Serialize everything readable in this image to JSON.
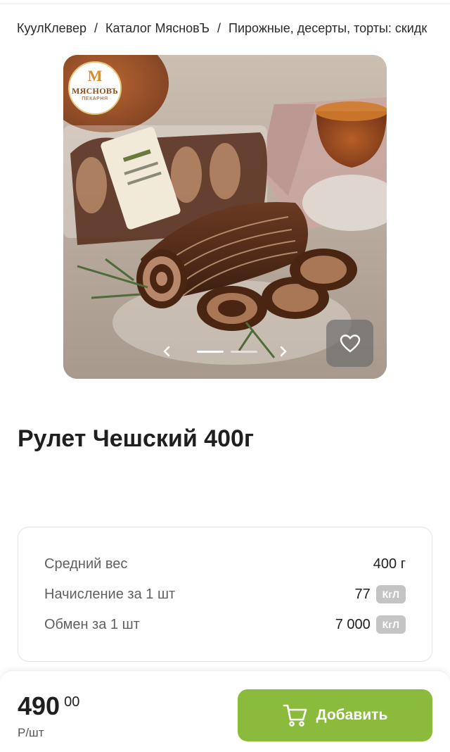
{
  "breadcrumb": {
    "items": [
      "КуулКлевер",
      "Каталог МясновЪ",
      "Пирожные, десерты, торты: скидк"
    ],
    "separator": "/"
  },
  "gallery": {
    "logo_text": "МЯСНОВЪ",
    "logo_sub": "ПЕКАРНЯ",
    "logo_letter": "М",
    "icons": {
      "prev": "chevron-left-icon",
      "next": "chevron-right-icon",
      "favorite": "heart-icon"
    },
    "slides_total": 2,
    "active_slide": 1
  },
  "product": {
    "title": "Рулет Чешский 400г"
  },
  "info": {
    "rows": [
      {
        "label": "Средний вес",
        "value": "400 г",
        "badge": ""
      },
      {
        "label": "Начисление за 1 шт",
        "value": "77",
        "badge": "КгЛ"
      },
      {
        "label": "Обмен за 1 шт",
        "value": "7 000",
        "badge": "КгЛ"
      }
    ]
  },
  "purchase": {
    "price_main": "490",
    "price_cents": "00",
    "price_unit": "Р/шт",
    "add_label": "Добавить",
    "add_icon": "cart-icon"
  },
  "colors": {
    "accent": "#8bbb3c",
    "badge": "#c4c4c4"
  }
}
